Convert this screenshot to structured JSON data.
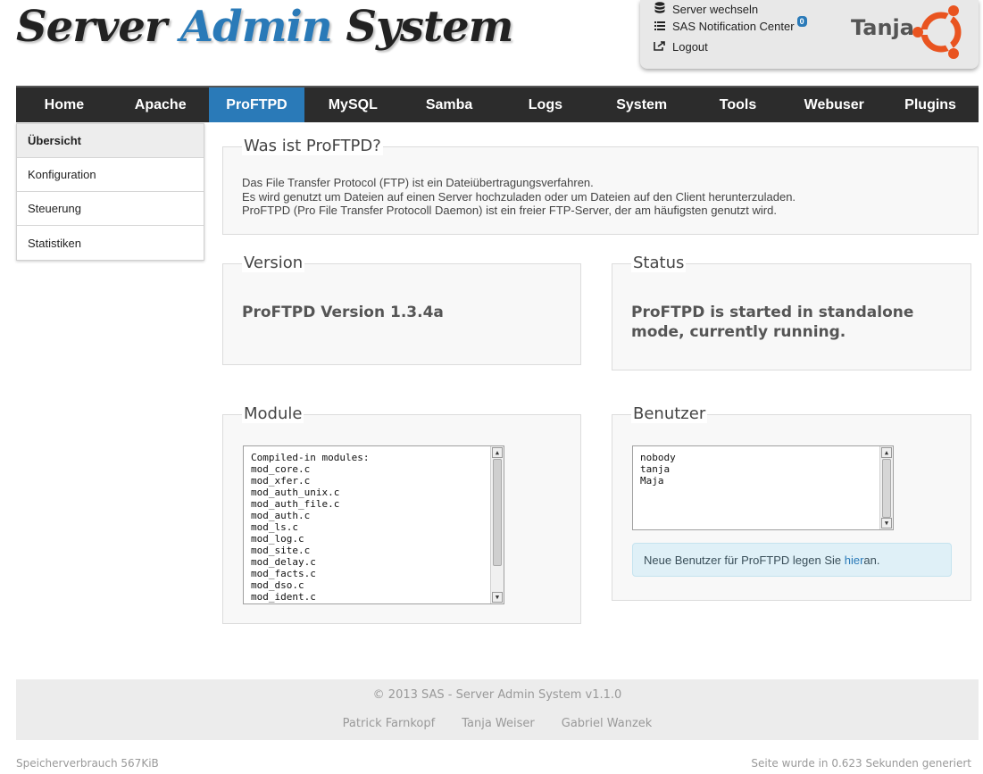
{
  "header": {
    "logo_part1": "Server ",
    "logo_part2": "Admin",
    "logo_part3": " System"
  },
  "user_panel": {
    "switch_server": "Server wechseln",
    "notification_center": "SAS Notification Center",
    "notification_count": "0",
    "logout": "Logout",
    "username": "Tanja",
    "icons": {
      "switch": "database-icon",
      "notifications": "list-icon",
      "logout": "logout-icon",
      "logo": "ubuntu-logo"
    }
  },
  "nav": {
    "items": [
      "Home",
      "Apache",
      "ProFTPD",
      "MySQL",
      "Samba",
      "Logs",
      "System",
      "Tools",
      "Webuser",
      "Plugins"
    ],
    "active": "ProFTPD"
  },
  "sidebar": {
    "items": [
      "Übersicht",
      "Konfiguration",
      "Steuerung",
      "Statistiken"
    ],
    "active": "Übersicht"
  },
  "about": {
    "title": "Was ist ProFTPD?",
    "line1": "Das File Transfer Protocol (FTP) ist ein Dateiübertragungsverfahren.",
    "line2": "Es wird genutzt um Dateien auf einen Server hochzuladen oder um Dateien auf den Client herunterzuladen.",
    "line3": "ProFTPD (Pro File Transfer Protocoll Daemon) ist ein freier FTP-Server, der am häufigsten genutzt wird."
  },
  "version": {
    "title": "Version",
    "text": "ProFTPD Version 1.3.4a"
  },
  "status": {
    "title": "Status",
    "text": "ProFTPD is started in standalone mode, currently running."
  },
  "modules": {
    "title": "Module",
    "lines": [
      "Compiled-in modules:",
      "mod_core.c",
      "mod_xfer.c",
      "mod_auth_unix.c",
      "mod_auth_file.c",
      "mod_auth.c",
      "mod_ls.c",
      "mod_log.c",
      "mod_site.c",
      "mod_delay.c",
      "mod_facts.c",
      "mod_dso.c",
      "mod_ident.c"
    ]
  },
  "users": {
    "title": "Benutzer",
    "lines": [
      "nobody",
      "tanja",
      "Maja"
    ],
    "hint_before": "Neue Benutzer für ProFTPD legen Sie ",
    "hint_link": "hier",
    "hint_after": " an."
  },
  "footer": {
    "copyright": "© 2013 SAS - Server Admin System v1.1.0",
    "authors": [
      "Patrick Farnkopf",
      "Tanja Weiser",
      "Gabriel Wanzek"
    ],
    "memory": "Speicherverbrauch 567KiB",
    "generated": "Seite wurde in 0.623 Sekunden generiert"
  },
  "colors": {
    "accent": "#2a7ab8",
    "nav_bg": "#2c2c2c",
    "ubuntu_orange": "#e95420"
  }
}
